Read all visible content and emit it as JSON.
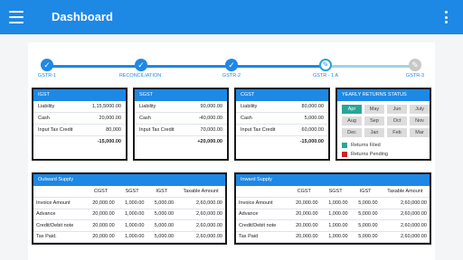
{
  "app": {
    "title": "Dashboard"
  },
  "stepper": {
    "steps": [
      "GSTR-1",
      "RECONCILIATION",
      "GSTR-2",
      "GSTR - 1 A",
      "GSTR-3"
    ]
  },
  "igst": {
    "title": "IGST",
    "rows": [
      {
        "label": "Liability",
        "value": "1,15,5000.00"
      },
      {
        "label": "Cash",
        "value": "20,000.00"
      },
      {
        "label": "Input Tax Credit",
        "value": "80,000"
      }
    ],
    "total": "-15,000.00"
  },
  "sgst": {
    "title": "SGST",
    "rows": [
      {
        "label": "Liability",
        "value": "90,000.00"
      },
      {
        "label": "Cash",
        "value": "-40,000.00"
      },
      {
        "label": "Input Tax Credit",
        "value": "70,000.00"
      }
    ],
    "total": "+20,000.00"
  },
  "cgst": {
    "title": "CGST",
    "rows": [
      {
        "label": "Liability",
        "value": "80,000.00"
      },
      {
        "label": "Cash",
        "value": "5,000.00"
      },
      {
        "label": "Input Tax Credit",
        "value": "60,000.00"
      }
    ],
    "total": "-15,000.00"
  },
  "yearly": {
    "title": "YEARLY RETURNS STATUS",
    "months": [
      "Apr",
      "May",
      "Jun",
      "July",
      "Aug",
      "Sep",
      "Oct",
      "Nov",
      "Dec",
      "Jan",
      "Feb",
      "Mar"
    ],
    "filed_months": [
      "Apr"
    ],
    "legend": {
      "filed": "Returns Filed",
      "pending": "Returns Pending"
    }
  },
  "colors": {
    "primary": "#1e88e5",
    "filed": "#26a69a",
    "pending": "#c62828",
    "step_pending": "#c8c8c8"
  },
  "outward": {
    "title": "Outward Supply",
    "columns": [
      "",
      "CGST",
      "SGST",
      "IGST",
      "Taxable Amount"
    ],
    "rows": [
      [
        "Invoice Amount",
        "20,000.00",
        "1,000.00",
        "5,000.00",
        "2,60,000.00"
      ],
      [
        "Advance",
        "20,000.00",
        "1,000.00",
        "5,000.00",
        "2,60,000.00"
      ],
      [
        "Credit/Debit note",
        "20,000.00",
        "1,000.00",
        "5,000.00",
        "2,60,000.00"
      ],
      [
        "Tax Paid.",
        "20,000.00",
        "1,000.00",
        "5,000.00",
        "2,60,000.00"
      ]
    ]
  },
  "inward": {
    "title": "Inward Supply",
    "columns": [
      "",
      "CGST",
      "SGST",
      "IGST",
      "Taxable Amount"
    ],
    "rows": [
      [
        "Invoice Amount",
        "20,000.00",
        "1,000.00",
        "5,000.00",
        "2,60,000.00"
      ],
      [
        "Advance",
        "20,000.00",
        "1,000.00",
        "5,000.00",
        "2,60,000.00"
      ],
      [
        "Credit/Debit note",
        "20,000.00",
        "1,000.00",
        "5,000.00",
        "2,60,000.00"
      ],
      [
        "Tax Paid",
        "20,000.00",
        "1,000.00",
        "5,000.00",
        "2,60,000.00"
      ]
    ]
  }
}
